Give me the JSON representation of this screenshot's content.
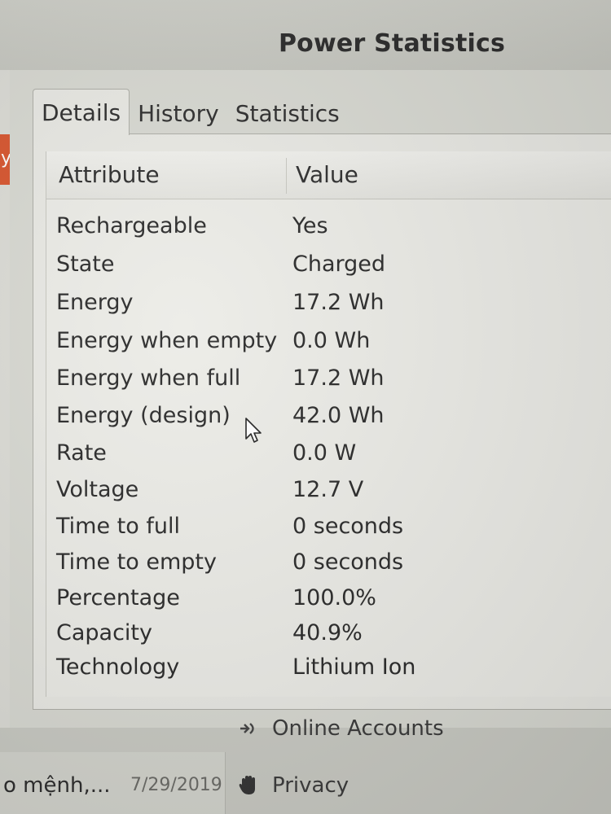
{
  "window": {
    "title": "Power Statistics"
  },
  "tabs": [
    {
      "label": "Details",
      "active": true
    },
    {
      "label": "History",
      "active": false
    },
    {
      "label": "Statistics",
      "active": false
    }
  ],
  "table": {
    "columns": [
      "Attribute",
      "Value"
    ],
    "rows": [
      {
        "attribute": "Rechargeable",
        "value": "Yes"
      },
      {
        "attribute": "State",
        "value": "Charged"
      },
      {
        "attribute": "Energy",
        "value": "17.2 Wh"
      },
      {
        "attribute": "Energy when empty",
        "value": "0.0 Wh"
      },
      {
        "attribute": "Energy when full",
        "value": "17.2 Wh"
      },
      {
        "attribute": "Energy (design)",
        "value": "42.0 Wh"
      },
      {
        "attribute": "Rate",
        "value": "0.0 W"
      },
      {
        "attribute": "Voltage",
        "value": "12.7 V"
      },
      {
        "attribute": "Time to full",
        "value": "0 seconds"
      },
      {
        "attribute": "Time to empty",
        "value": "0 seconds"
      },
      {
        "attribute": "Percentage",
        "value": "100.0%"
      },
      {
        "attribute": "Capacity",
        "value": "40.9%"
      },
      {
        "attribute": "Technology",
        "value": "Lithium Ion"
      }
    ]
  },
  "background": {
    "left_glyph": "y",
    "list_item_text": "o mệnh,...",
    "list_item_date": "7/29/2019",
    "settings_items": [
      {
        "label": "Online Accounts",
        "icon": "online-accounts-icon"
      },
      {
        "label": "Privacy",
        "icon": "privacy-hand-icon"
      }
    ]
  },
  "colors": {
    "accent_red": "#d8552e",
    "text": "#2a2a2a",
    "panel_bg": "#e9e9e4"
  }
}
